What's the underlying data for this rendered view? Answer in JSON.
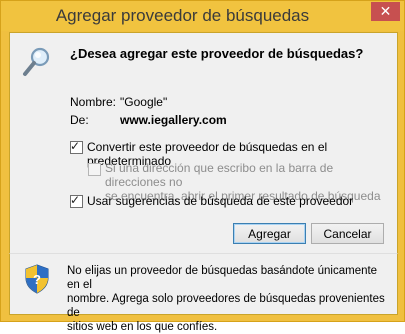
{
  "window": {
    "title": "Agregar proveedor de búsquedas",
    "close_label": "✕"
  },
  "dialog": {
    "question": "¿Desea agregar este proveedor de búsquedas?",
    "name_label": "Nombre:",
    "name_value": "\"Google\"",
    "from_label": "De:",
    "from_value": "www.iegallery.com"
  },
  "options": [
    {
      "label": "Convertir este proveedor de búsquedas en el predeterminado",
      "checked": true,
      "enabled": true
    },
    {
      "label_line1": "Si una dirección que escribo en la barra de direcciones no",
      "label_line2": "se encuentra, abrir el primer resultado de búsqueda",
      "checked": false,
      "enabled": false
    },
    {
      "label": "Usar sugerencias de búsqueda de este proveedor",
      "checked": true,
      "enabled": true
    }
  ],
  "buttons": {
    "add": "Agregar",
    "cancel": "Cancelar"
  },
  "footer": {
    "line1": "No elijas un proveedor de búsquedas basándote únicamente en el",
    "line2": "nombre. Agrega solo proveedores de búsquedas provenientes de",
    "line3": "sitios web en los que confíes."
  },
  "colors": {
    "frame": "#f1c33f",
    "close": "#c75050",
    "client": "#f0f0f0"
  },
  "icons": [
    "search-icon",
    "shield-icon",
    "close-icon",
    "check-icon"
  ]
}
